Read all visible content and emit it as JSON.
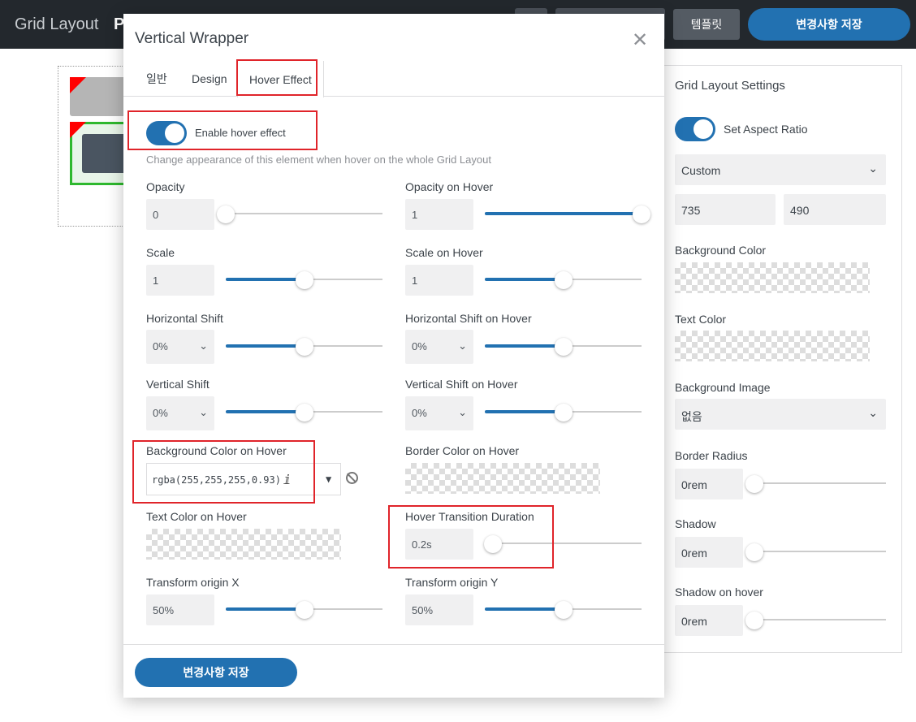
{
  "topbar": {
    "app_title": "Grid Layout",
    "app_title_extra": "P",
    "template_label": "템플릿",
    "save_label": "변경사항 저장"
  },
  "modal": {
    "title": "Vertical Wrapper",
    "tabs": [
      {
        "label": "일반"
      },
      {
        "label": "Design"
      },
      {
        "label": "Hover Effect",
        "active": true
      }
    ],
    "enable_hover": {
      "label": "Enable hover effect",
      "on": true
    },
    "description": "Change appearance of this element when hover on the whole Grid Layout",
    "fields": {
      "opacity": {
        "label": "Opacity",
        "value": "0",
        "level": 0.0
      },
      "opacity_hover": {
        "label": "Opacity on Hover",
        "value": "1",
        "level": 1.0
      },
      "scale": {
        "label": "Scale",
        "value": "1",
        "level": 0.5
      },
      "scale_hover": {
        "label": "Scale on Hover",
        "value": "1",
        "level": 0.5
      },
      "hshift": {
        "label": "Horizontal Shift",
        "value": "0%",
        "level": 0.5
      },
      "hshift_hover": {
        "label": "Horizontal Shift on Hover",
        "value": "0%",
        "level": 0.5
      },
      "vshift": {
        "label": "Vertical Shift",
        "value": "0%",
        "level": 0.5
      },
      "vshift_hover": {
        "label": "Vertical Shift on Hover",
        "value": "0%",
        "level": 0.5
      },
      "bg_hover": {
        "label": "Background Color on Hover",
        "value": "rgba(255,255,255,0.93)"
      },
      "border_hover": {
        "label": "Border Color on Hover"
      },
      "text_hover": {
        "label": "Text Color on Hover"
      },
      "transition": {
        "label": "Hover Transition Duration",
        "value": "0.2s",
        "level": 0.05
      },
      "origin_x": {
        "label": "Transform origin X",
        "value": "50%",
        "level": 0.5
      },
      "origin_y": {
        "label": "Transform origin Y",
        "value": "50%",
        "level": 0.5
      }
    },
    "footer_save_label": "변경사항 저장"
  },
  "settings_panel": {
    "title": "Grid Layout Settings",
    "aspect_ratio": {
      "label": "Set Aspect Ratio",
      "on": true
    },
    "ratio_select": "Custom",
    "width": "735",
    "height": "490",
    "bg_color_label": "Background Color",
    "text_color_label": "Text Color",
    "bg_image_label": "Background Image",
    "bg_image_value": "없음",
    "border_radius": {
      "label": "Border Radius",
      "value": "0rem",
      "level": 0.0
    },
    "shadow": {
      "label": "Shadow",
      "value": "0rem",
      "level": 0.0
    },
    "shadow_hover": {
      "label": "Shadow on hover",
      "value": "0rem",
      "level": 0.0
    }
  },
  "colors": {
    "accent": "#2271b1",
    "highlight": "#e0242a",
    "topbar": "#23282d"
  }
}
